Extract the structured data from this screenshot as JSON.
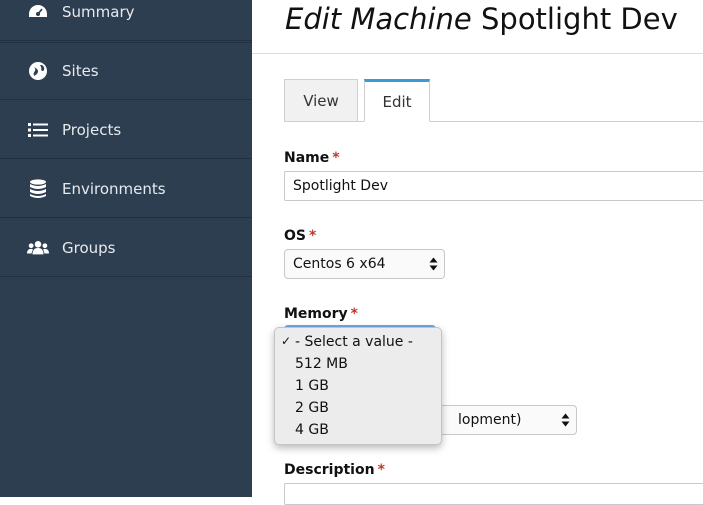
{
  "sidebar": {
    "items": [
      {
        "label": "Summary",
        "icon": "dashboard-icon"
      },
      {
        "label": "Sites",
        "icon": "globe-icon"
      },
      {
        "label": "Projects",
        "icon": "list-icon"
      },
      {
        "label": "Environments",
        "icon": "database-icon"
      },
      {
        "label": "Groups",
        "icon": "users-icon"
      }
    ]
  },
  "header": {
    "title_strong": "Edit Machine",
    "title_name": "Spotlight Dev"
  },
  "tabs": [
    {
      "label": "View",
      "active": false
    },
    {
      "label": "Edit",
      "active": true
    }
  ],
  "form": {
    "name": {
      "label": "Name",
      "required": "*",
      "value": "Spotlight Dev"
    },
    "os": {
      "label": "OS",
      "required": "*",
      "value": "Centos 6 x64"
    },
    "memory": {
      "label": "Memory",
      "required": "*",
      "options": [
        "- Select a value -",
        "512 MB",
        "1 GB",
        "2 GB",
        "4 GB"
      ],
      "checked_mark": "✓"
    },
    "environment": {
      "value_visible": "lopment)"
    },
    "description": {
      "label": "Description",
      "required": "*"
    }
  },
  "colors": {
    "sidebar_bg": "#2d3e50",
    "accent": "#3a9ad9",
    "required": "#c0392b"
  }
}
